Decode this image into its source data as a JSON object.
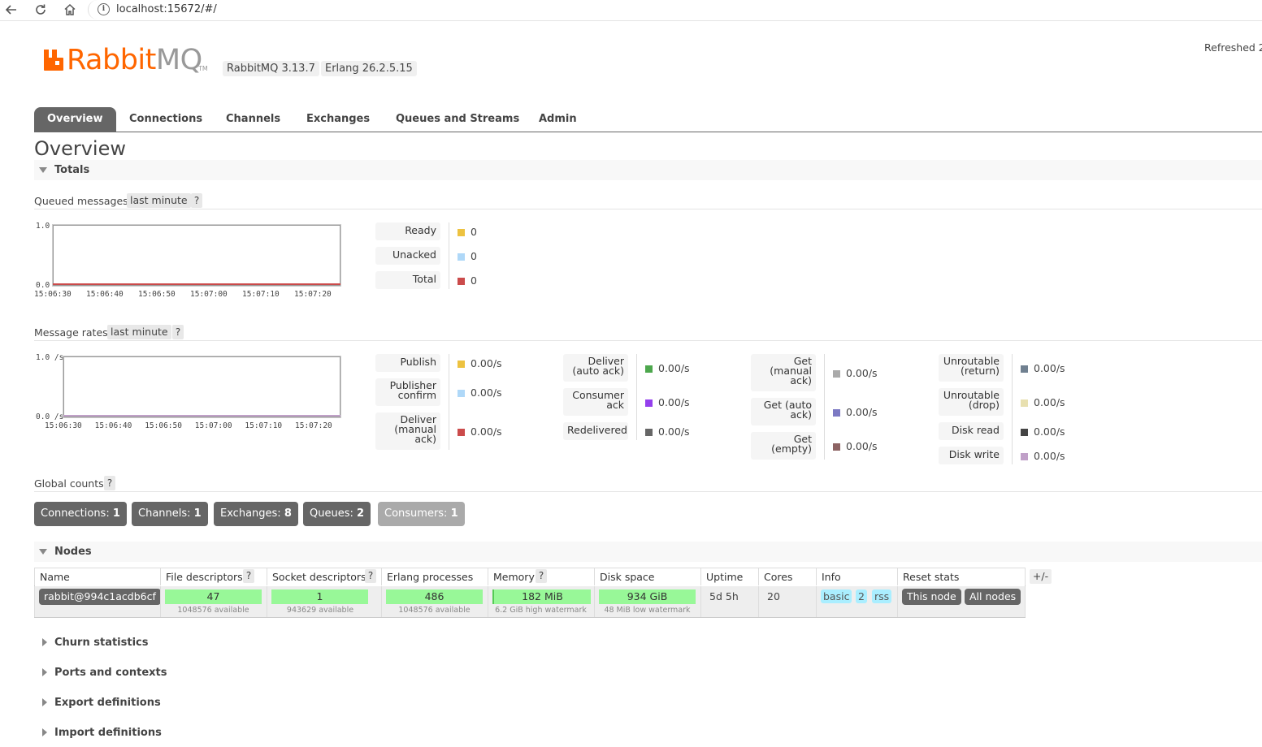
{
  "browser": {
    "url": "localhost:15672/#/",
    "back_icon": "arrow-left-icon",
    "reload_icon": "reload-icon",
    "home_icon": "home-icon",
    "info_icon": "info-icon"
  },
  "header": {
    "logo_rabbit": "Rabbit",
    "logo_mq": "MQ",
    "logo_tm": "TM",
    "rabbitmq_version": "RabbitMQ 3.13.7",
    "erlang_version": "Erlang 26.2.5.15",
    "refreshed": "Refreshed 2"
  },
  "tabs": [
    "Overview",
    "Connections",
    "Channels",
    "Exchanges",
    "Queues and Streams",
    "Admin"
  ],
  "page_title": "Overview",
  "totals": {
    "title": "Totals",
    "queued": {
      "label": "Queued messages",
      "range": "last minute",
      "help": "?",
      "y_max": "1.0",
      "y_min": "0.0",
      "x_ticks": [
        "15:06:30",
        "15:06:40",
        "15:06:50",
        "15:07:00",
        "15:07:10",
        "15:07:20"
      ],
      "legend": [
        {
          "label": "Ready",
          "value": "0",
          "color": "#edc240"
        },
        {
          "label": "Unacked",
          "value": "0",
          "color": "#afd8f8"
        },
        {
          "label": "Total",
          "value": "0",
          "color": "#cb4b4b"
        }
      ]
    },
    "rates": {
      "label": "Message rates",
      "range": "last minute",
      "help": "?",
      "y_max": "1.0 /s",
      "y_min": "0.0 /s",
      "x_ticks": [
        "15:06:30",
        "15:06:40",
        "15:06:50",
        "15:07:00",
        "15:07:10",
        "15:07:20"
      ],
      "col1": [
        {
          "label": "Publish",
          "value": "0.00/s",
          "color": "#edc240"
        },
        {
          "label": "Publisher confirm",
          "value": "0.00/s",
          "color": "#afd8f8"
        },
        {
          "label": "Deliver (manual ack)",
          "value": "0.00/s",
          "color": "#cb4b4b"
        }
      ],
      "col2": [
        {
          "label": "Deliver (auto ack)",
          "value": "0.00/s",
          "color": "#4da74d"
        },
        {
          "label": "Consumer ack",
          "value": "0.00/s",
          "color": "#9440ed"
        },
        {
          "label": "Redelivered",
          "value": "0.00/s",
          "color": "#666666"
        }
      ],
      "col3": [
        {
          "label": "Get (manual ack)",
          "value": "0.00/s",
          "color": "#aaaaaa"
        },
        {
          "label": "Get (auto ack)",
          "value": "0.00/s",
          "color": "#7c79c3"
        },
        {
          "label": "Get (empty)",
          "value": "0.00/s",
          "color": "#8d6363"
        }
      ],
      "col4": [
        {
          "label": "Unroutable (return)",
          "value": "0.00/s",
          "color": "#708090"
        },
        {
          "label": "Unroutable (drop)",
          "value": "0.00/s",
          "color": "#e8e0b0"
        },
        {
          "label": "Disk read",
          "value": "0.00/s",
          "color": "#444444"
        },
        {
          "label": "Disk write",
          "value": "0.00/s",
          "color": "#c0a0c8"
        }
      ]
    }
  },
  "global_counts": {
    "label": "Global counts",
    "help": "?",
    "items": [
      {
        "label": "Connections:",
        "value": "1"
      },
      {
        "label": "Channels:",
        "value": "1"
      },
      {
        "label": "Exchanges:",
        "value": "8"
      },
      {
        "label": "Queues:",
        "value": "2"
      },
      {
        "label": "Consumers:",
        "value": "1"
      }
    ]
  },
  "nodes": {
    "title": "Nodes",
    "columns": [
      "Name",
      "File descriptors",
      "Socket descriptors",
      "Erlang processes",
      "Memory",
      "Disk space",
      "Uptime",
      "Cores",
      "Info",
      "Reset stats"
    ],
    "help": "?",
    "plusminus": "+/-",
    "row": {
      "name": "rabbit@994c1acdb6cf",
      "fd": "47",
      "fd_sub": "1048576 available",
      "sd": "1",
      "sd_sub": "943629 available",
      "ep": "486",
      "ep_sub": "1048576 available",
      "mem": "182 MiB",
      "mem_sub": "6.2 GiB high watermark",
      "disk": "934 GiB",
      "disk_sub": "48 MiB low watermark",
      "uptime": "5d 5h",
      "cores": "20",
      "info": [
        "basic",
        "2",
        "rss"
      ],
      "reset_this": "This node",
      "reset_all": "All nodes"
    }
  },
  "collapsed_sections": [
    "Churn statistics",
    "Ports and contexts",
    "Export definitions",
    "Import definitions"
  ]
}
